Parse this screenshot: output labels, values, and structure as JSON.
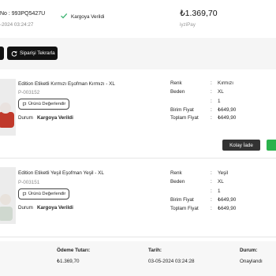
{
  "header": {
    "order_no": "No : 993PQ5427U",
    "order_date": "-2024 03:24:27",
    "status": "Kargoya Verildi",
    "total": "₺1.369,70",
    "payment": "iyziPay"
  },
  "toolbar": {
    "reorder_label": "Siparişi Tekrarla"
  },
  "products": [
    {
      "name": "Edition Etiketli Kırmızı Eşofman Kırmızı - XL",
      "code": "P-003152",
      "review_label": "Ürünü Değerlendir",
      "state_label": "Durum",
      "state_value": "Kargoya Verildi",
      "specs": [
        {
          "label": "Renk",
          "value": "Kırmızı"
        },
        {
          "label": "Beden",
          "value": "XL"
        },
        {
          "label": "",
          "value": "1"
        },
        {
          "label": "Birim Fiyat",
          "value": "₺649,90"
        },
        {
          "label": "Toplam Fiyat",
          "value": "₺649,90"
        }
      ]
    },
    {
      "name": "Edition Etiketli Yeşil Eşofman Yeşil - XL",
      "code": "P-003151",
      "review_label": "Ürünü Değerlendir",
      "state_label": "Durum",
      "state_value": "Kargoya Verildi",
      "specs": [
        {
          "label": "Renk",
          "value": "Yeşil"
        },
        {
          "label": "Beden",
          "value": "XL"
        },
        {
          "label": "",
          "value": "1"
        },
        {
          "label": "Birim Fiyat",
          "value": "₺649,90"
        },
        {
          "label": "Toplam Fiyat",
          "value": "₺649,90"
        }
      ]
    }
  ],
  "actions": {
    "easy_return_label": "Kolay İade"
  },
  "footer": {
    "payment_label": "Ödeme Tutarı:",
    "payment_value": "₺1.369,70",
    "date_label": "Tarih:",
    "date_value": "03-05-2024 03:24:28",
    "status_label": "Durum:",
    "status_value": "Onaylandı"
  },
  "colors": {
    "accent": "#111111",
    "success": "#2bb24c",
    "check": "#3cb371"
  }
}
